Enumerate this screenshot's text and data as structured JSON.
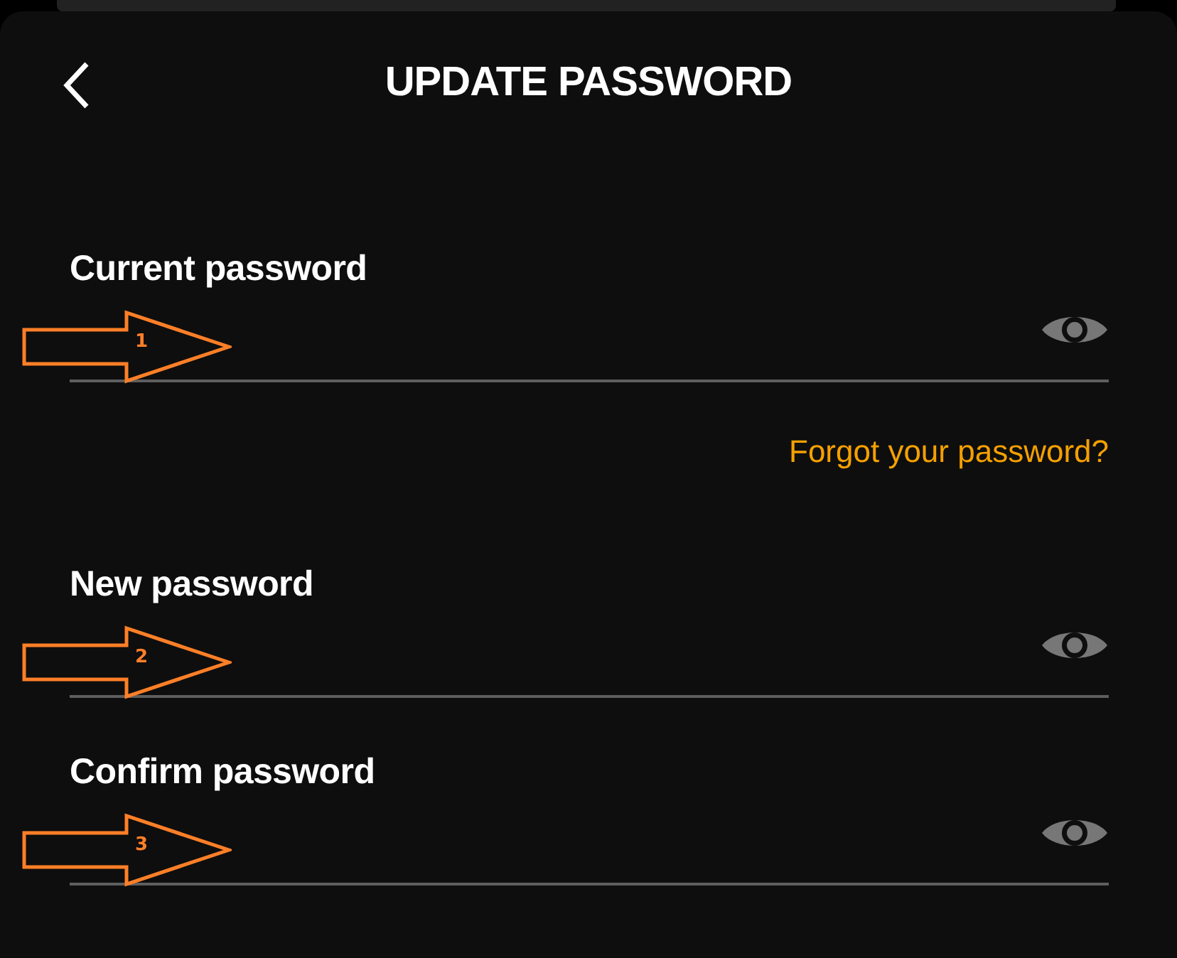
{
  "header": {
    "title": "UPDATE PASSWORD"
  },
  "items": [
    {
      "kind": "field",
      "label": "Current password",
      "callout": "1"
    },
    {
      "kind": "link",
      "text": "Forgot your password?"
    },
    {
      "kind": "field",
      "label": "New password",
      "callout": "2"
    },
    {
      "kind": "field",
      "label": "Confirm password",
      "callout": "3"
    }
  ]
}
